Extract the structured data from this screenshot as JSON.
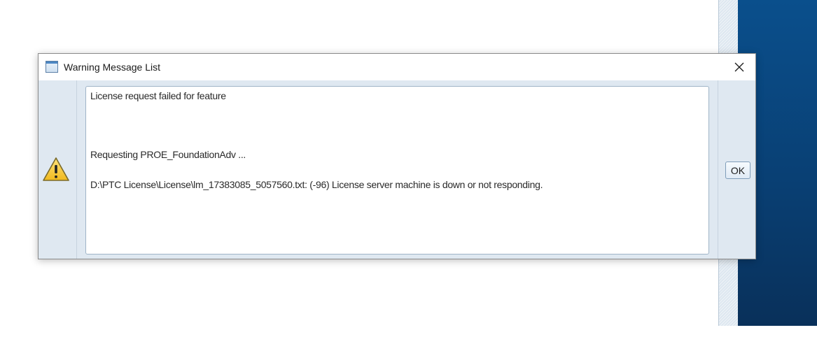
{
  "dialog": {
    "title": "Warning Message List",
    "close_icon": "close-icon",
    "app_icon": "window-icon",
    "warning_icon": "warning-triangle-icon",
    "messages": {
      "line1": "License request failed for feature",
      "line2": "Requesting PROE_FoundationAdv ...",
      "line3": "D:\\PTC License\\License\\lm_17383085_5057560.txt: (-96) License server machine is down or not responding."
    },
    "ok_label": "OK"
  },
  "colors": {
    "background_blue": "#0a4f8c",
    "dialog_body": "#dfe8f1",
    "warning_yellow": "#f6c530"
  }
}
